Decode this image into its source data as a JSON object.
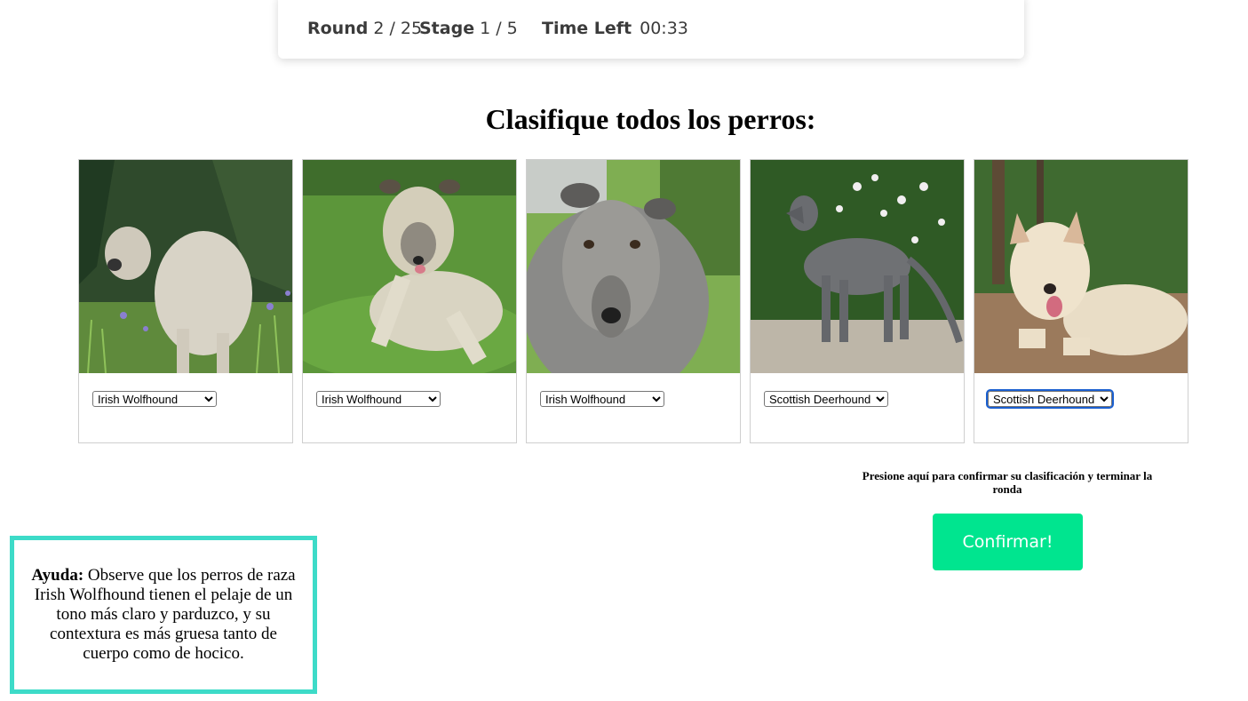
{
  "status": {
    "round_label": "Round",
    "round_value": "2 / 25",
    "stage_label": "Stage",
    "stage_value": "1 / 5",
    "time_label": "Time Left",
    "time_value": "00:33"
  },
  "title": "Clasifique todos los perros:",
  "breed_options": [
    "Irish Wolfhound",
    "Scottish Deerhound"
  ],
  "dogs": [
    {
      "selected": "Irish Wolfhound"
    },
    {
      "selected": "Irish Wolfhound"
    },
    {
      "selected": "Irish Wolfhound"
    },
    {
      "selected": "Scottish Deerhound"
    },
    {
      "selected": "Scottish Deerhound"
    }
  ],
  "confirm": {
    "caption": "Presione aquí para confirmar su clasificación y terminar la ronda",
    "button_label": "Confirmar!"
  },
  "help": {
    "label": "Ayuda:",
    "text": "Observe que los perros de raza Irish Wolfhound tienen el pelaje de un tono más claro y parduzco, y su contextura es más gruesa tanto de cuerpo como de hocico."
  },
  "colors": {
    "confirm_button": "#00e58f",
    "help_border": "#3ddbc8",
    "focus_outline": "#1a5fd0"
  }
}
